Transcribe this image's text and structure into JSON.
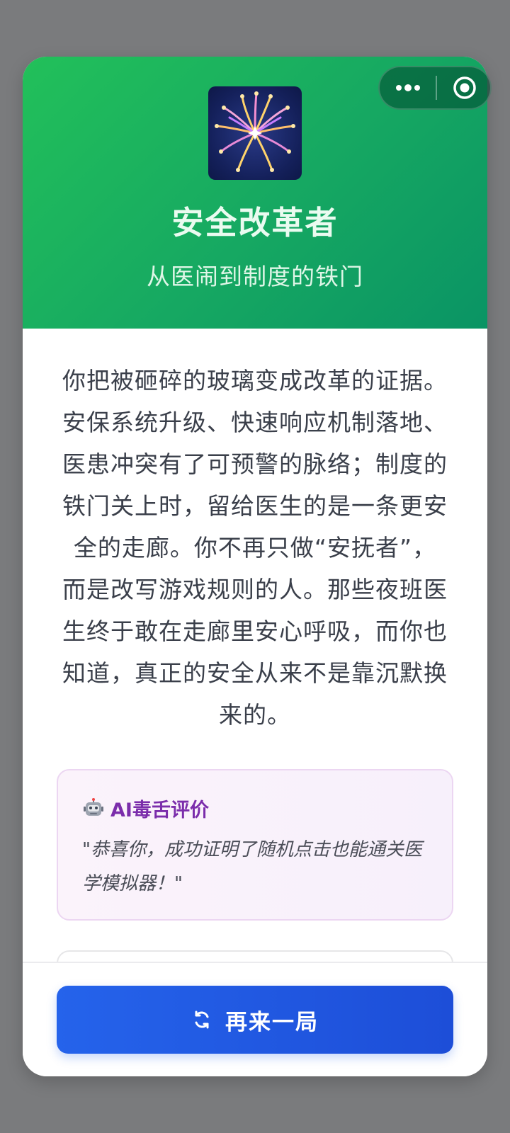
{
  "header": {
    "icon": "fireworks-icon",
    "title": "安全改革者",
    "subtitle": "从医闹到制度的铁门"
  },
  "menu": {
    "more_icon": "more-dots-icon",
    "close_icon": "close-circle-icon"
  },
  "body": {
    "text": "你把被砸碎的玻璃变成改革的证据。安保系统升级、快速响应机制落地、医患冲突有了可预警的脉络；制度的铁门关上时，留给医生的是一条更安全的走廊。你不再只做“安抚者”，而是改写游戏规则的人。那些夜班医生终于敢在走廊里安心呼吸，而你也知道，真正的安全从来不是靠沉默换来的。"
  },
  "ai_review": {
    "icon": "robot-icon",
    "title": "AI毒舌评价",
    "quote": "\"恭喜你，成功证明了随机点击也能通关医学模拟器！\""
  },
  "footer": {
    "replay_icon": "refresh-icon",
    "replay_label": "再来一局"
  },
  "colors": {
    "header_green": "#1bb05e",
    "button_blue": "#2563eb",
    "ai_title_purple": "#7b2dab"
  }
}
